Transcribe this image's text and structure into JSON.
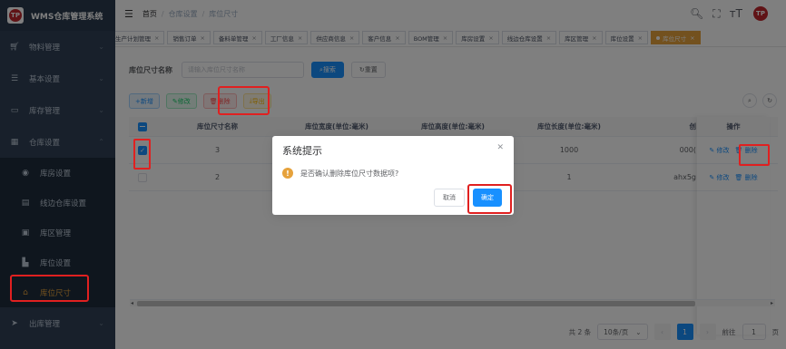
{
  "app": {
    "title": "WMS仓库管理系统",
    "logo_text": "TP"
  },
  "sidebar": {
    "items": [
      {
        "label": "物料管理",
        "icon": "cart-icon",
        "glyph": "🛒︎"
      },
      {
        "label": "基本设置",
        "icon": "sliders-icon",
        "glyph": "☰"
      },
      {
        "label": "库存管理",
        "icon": "monitor-icon",
        "glyph": "▭"
      },
      {
        "label": "仓库设置",
        "icon": "grid-icon",
        "glyph": "▦"
      }
    ],
    "sub_items": [
      {
        "label": "库房设置",
        "icon": "github-icon",
        "glyph": "◉"
      },
      {
        "label": "线边仓库设置",
        "icon": "list-icon",
        "glyph": "▤"
      },
      {
        "label": "库区管理",
        "icon": "box-icon",
        "glyph": "▣"
      },
      {
        "label": "库位设置",
        "icon": "book-icon",
        "glyph": "▙"
      },
      {
        "label": "库位尺寸",
        "icon": "home-icon",
        "glyph": "⌂"
      }
    ],
    "bottom_item": {
      "label": "出库管理",
      "icon": "send-icon",
      "glyph": "➤"
    }
  },
  "header": {
    "breadcrumb": [
      "首页",
      "仓库设置",
      "库位尺寸"
    ],
    "icons": {
      "search": "🔍︎",
      "fullscreen": "⛶",
      "size": "тT"
    }
  },
  "tags": [
    {
      "label": "生产计划管理"
    },
    {
      "label": "销售订单"
    },
    {
      "label": "备料单管理"
    },
    {
      "label": "工厂信息"
    },
    {
      "label": "供应商信息"
    },
    {
      "label": "客户信息"
    },
    {
      "label": "BOM管理"
    },
    {
      "label": "库房设置"
    },
    {
      "label": "线边仓库设置"
    },
    {
      "label": "库区管理"
    },
    {
      "label": "库位设置"
    },
    {
      "label": "库位尺寸",
      "active": true
    }
  ],
  "search": {
    "label": "库位尺寸名称",
    "placeholder": "请输入库位尺寸名称",
    "search_btn": "搜索",
    "reset_btn": "重置"
  },
  "toolbar": {
    "add": "新增",
    "edit": "修改",
    "delete": "删除",
    "export": "导出"
  },
  "table": {
    "headers": {
      "name": "库位尺寸名称",
      "width": "库位宽度(单位:毫米)",
      "height": "库位高度(单位:毫米)",
      "length": "库位长度(单位:毫米)",
      "creator": "创",
      "ops": "操作"
    },
    "rows": [
      {
        "checked": true,
        "name": "3",
        "width": "",
        "height": "",
        "length": "1000",
        "creator": "000(",
        "edit": "修改",
        "delete": "删除"
      },
      {
        "checked": false,
        "name": "2",
        "width": "",
        "height": "",
        "length": "1",
        "creator": "ahx5g",
        "edit": "修改",
        "delete": "删除"
      }
    ]
  },
  "pagination": {
    "total": "共 2 条",
    "page_size": "10条/页",
    "current": "1",
    "goto_label": "前往",
    "goto_value": "1",
    "page_suffix": "页"
  },
  "dialog": {
    "title": "系统提示",
    "message": "是否确认删除库位尺寸数据项?",
    "cancel": "取消",
    "confirm": "确定"
  },
  "colors": {
    "sidebar_bg": "#304156",
    "primary": "#1890ff",
    "active_tag": "#e6a23c",
    "highlight": "#e02020"
  }
}
